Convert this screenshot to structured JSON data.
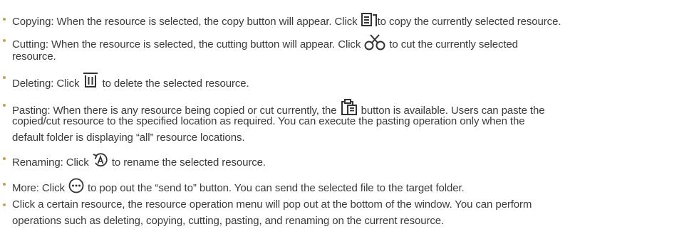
{
  "items": [
    {
      "lines": [
        [
          "Copying: When the resource is selected, the copy button will appear. Click ",
          "to copy the currently selected resource."
        ]
      ],
      "icon": "copy-icon"
    },
    {
      "lines": [
        [
          "Cutting: When the resource is selected, the cutting button will appear. Click ",
          " to cut the currently selected"
        ],
        [
          "resource."
        ]
      ],
      "icon": "scissors-icon"
    },
    {
      "lines": [
        [
          "Deleting: Click ",
          " to delete the selected resource."
        ]
      ],
      "icon": "trash-icon"
    },
    {
      "lines": [
        [
          "Pasting: When there is any resource being copied or cut currently, the ",
          " button is available. Users can paste the"
        ],
        [
          "copied/cut resource to the specified location as required. You can execute the pasting operation only when the"
        ],
        [
          "default folder is displaying “all” resource locations."
        ]
      ],
      "icon": "paste-icon"
    },
    {
      "lines": [
        [
          "Renaming: Click ",
          " to rename the selected resource."
        ]
      ],
      "icon": "rename-icon"
    },
    {
      "lines": [
        [
          "More: Click ",
          " to pop out the “send to” button. You can send the selected file to the target folder."
        ]
      ],
      "icon": "more-icon"
    },
    {
      "lines": [
        [
          "Click a certain resource, the resource operation menu will pop out at the bottom of the window. You can perform"
        ],
        [
          "operations such as deleting, copying, cutting, pasting, and renaming on the current resource."
        ]
      ]
    }
  ],
  "colors": {
    "text": "#3a3a3a",
    "bullet": "#c4a14e",
    "icon": "#333333"
  }
}
